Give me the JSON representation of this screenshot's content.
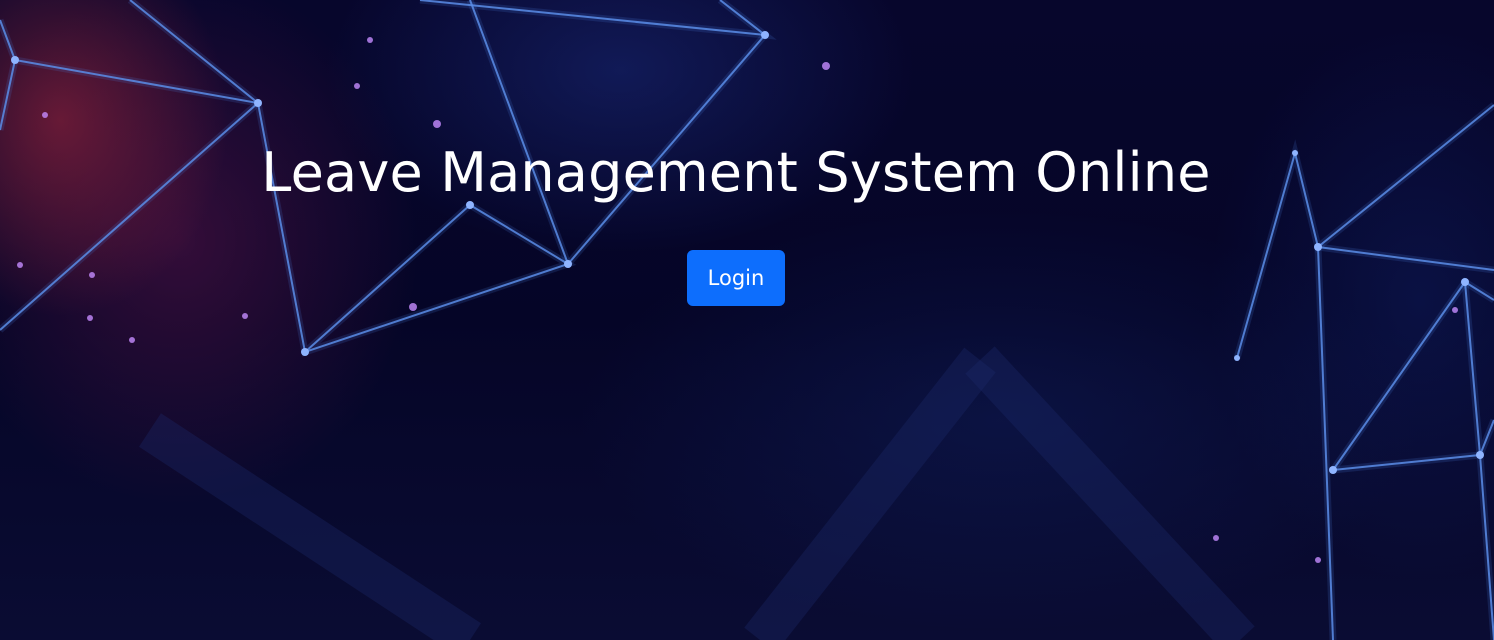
{
  "hero": {
    "title": "Leave Management System Online",
    "login_button": "Login",
    "background_icon": "network-mesh-background",
    "accent_color": "#0d6efd",
    "text_color": "#ffffff",
    "background_color": "#05052a"
  }
}
